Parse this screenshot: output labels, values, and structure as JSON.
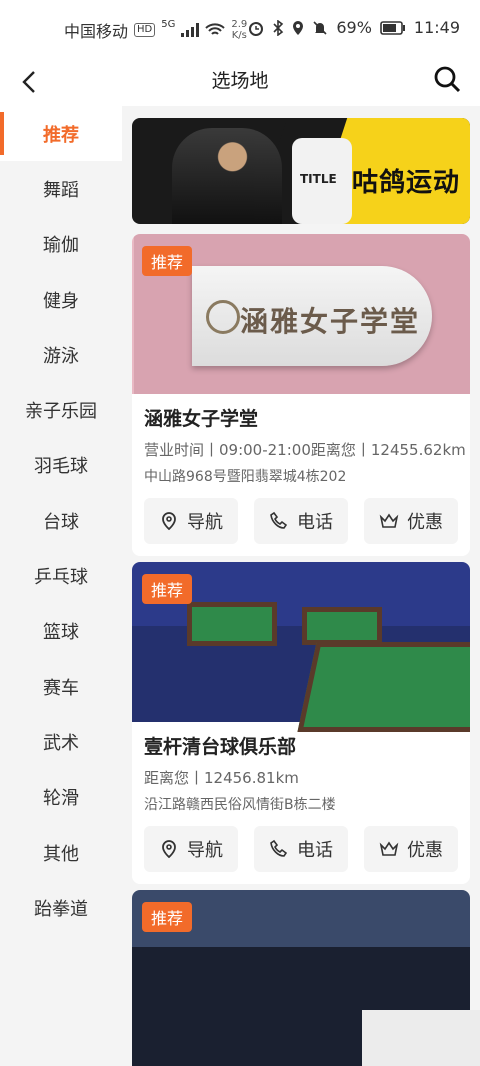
{
  "status_bar": {
    "carrier": "中国移动",
    "hd": "HD",
    "network": "5G",
    "speed": "2.9\nK/s",
    "battery": "69%",
    "time": "11:49"
  },
  "header": {
    "title": "选场地"
  },
  "sidebar": {
    "items": [
      {
        "label": "推荐",
        "active": true
      },
      {
        "label": "舞蹈"
      },
      {
        "label": "瑜伽"
      },
      {
        "label": "健身"
      },
      {
        "label": "游泳"
      },
      {
        "label": "亲子乐园"
      },
      {
        "label": "羽毛球"
      },
      {
        "label": "台球"
      },
      {
        "label": "乒乓球"
      },
      {
        "label": "篮球"
      },
      {
        "label": "赛车"
      },
      {
        "label": "武术"
      },
      {
        "label": "轮滑"
      },
      {
        "label": "其他"
      },
      {
        "label": "跆拳道"
      }
    ]
  },
  "banner": {
    "text": "咕鸽运动",
    "bag_text": "TITLE"
  },
  "venues": [
    {
      "badge": "推荐",
      "name": "涵雅女子学堂",
      "sign_text": "涵雅女子学堂",
      "meta": "营业时间丨09:00-21:00距离您丨12455.62km",
      "address": "中山路968号暨阳翡翠城4栋202",
      "actions": {
        "nav": "导航",
        "phone": "电话",
        "discount": "优惠"
      }
    },
    {
      "badge": "推荐",
      "name": "壹杆清台球俱乐部",
      "meta": "距离您丨12456.81km",
      "address": "沿江路赣西民俗风情街B栋二楼",
      "actions": {
        "nav": "导航",
        "phone": "电话",
        "discount": "优惠"
      }
    },
    {
      "badge": "推荐"
    }
  ],
  "colors": {
    "accent": "#f26b2a"
  }
}
